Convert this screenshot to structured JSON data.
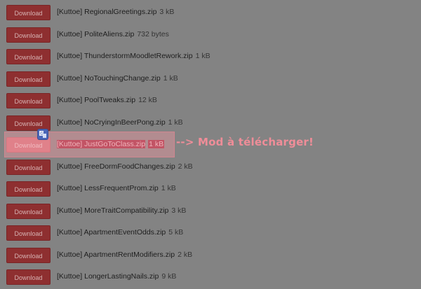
{
  "download_label": "Download",
  "files": [
    {
      "name": "[Kuttoe] RegionalGreetings.zip",
      "size": "3 kB"
    },
    {
      "name": "[Kuttoe] PoliteAliens.zip",
      "size": "732 bytes"
    },
    {
      "name": "[Kuttoe] ThunderstormMoodletRework.zip",
      "size": "1 kB"
    },
    {
      "name": "[Kuttoe] NoTouchingChange.zip",
      "size": "1 kB"
    },
    {
      "name": "[Kuttoe] PoolTweaks.zip",
      "size": "12 kB"
    },
    {
      "name": "[Kuttoe] NoCryingInBeerPong.zip",
      "size": "1 kB"
    },
    {
      "name": "[Kuttoe] JustGoToClass.zip",
      "size": "1 kB"
    },
    {
      "name": "[Kuttoe] FreeDormFoodChanges.zip",
      "size": "2 kB"
    },
    {
      "name": "[Kuttoe] LessFrequentProm.zip",
      "size": "1 kB"
    },
    {
      "name": "[Kuttoe] MoreTraitCompatibility.zip",
      "size": "3 kB"
    },
    {
      "name": "[Kuttoe] ApartmentEventOdds.zip",
      "size": "5 kB"
    },
    {
      "name": "[Kuttoe] ApartmentRentModifiers.zip",
      "size": "2 kB"
    },
    {
      "name": "[Kuttoe] LongerLastingNails.zip",
      "size": "9 kB"
    }
  ],
  "highlighted_index": 6,
  "annotation": {
    "text": "--> Mod à télécharger!"
  },
  "colors": {
    "overlay_background": "#838383",
    "download_button": "#8e2f30",
    "highlight": "#ef8d98",
    "selection": "#a01e35"
  },
  "icons": {
    "translate": "translate-icon"
  }
}
